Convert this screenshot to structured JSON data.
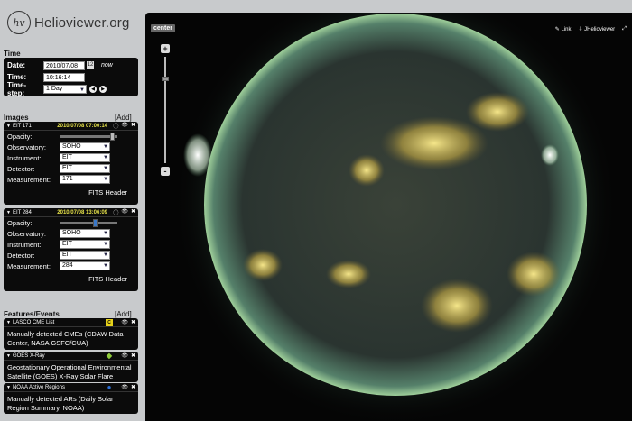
{
  "app": {
    "title": "Helioviewer.org",
    "logo_mark": "hv"
  },
  "time": {
    "section_title": "Time",
    "date_label": "Date:",
    "date_value": "2010/07/08",
    "now_label": "now",
    "time_label": "Time:",
    "time_value": "10:16:14",
    "step_label": "Time-step:",
    "step_value": "1 Day"
  },
  "images": {
    "section_title": "Images",
    "add_label": "[Add]",
    "layers": [
      {
        "name": "EIT 171",
        "timestamp": "2010/07/08 07:00:14",
        "opacity_label": "Opacity:",
        "opacity": 0.95,
        "observatory_label": "Observatory:",
        "observatory": "SOHO",
        "instrument_label": "Instrument:",
        "instrument": "EIT",
        "detector_label": "Detector:",
        "detector": "EIT",
        "measurement_label": "Measurement:",
        "measurement": "171",
        "fits_label": "FITS Header"
      },
      {
        "name": "EIT 284",
        "timestamp": "2010/07/08 13:06:09",
        "opacity_label": "Opacity:",
        "opacity": 0.62,
        "observatory_label": "Observatory:",
        "observatory": "SOHO",
        "instrument_label": "Instrument:",
        "instrument": "EIT",
        "detector_label": "Detector:",
        "detector": "EIT",
        "measurement_label": "Measurement:",
        "measurement": "284",
        "fits_label": "FITS Header"
      }
    ]
  },
  "features": {
    "section_title": "Features/Events",
    "add_label": "[Add]",
    "items": [
      {
        "name": "LASCO CME List",
        "badge": "C",
        "badge_color": "#e6d21a",
        "description": "Manually detected CMEs (CDAW Data Center, NASA GSFC/CUA)"
      },
      {
        "name": "GOES X-Ray",
        "badge": "◆",
        "badge_color": "#8ecb3a",
        "description": "Geostationary Operational Environmental Satellite (GOES) X-Ray Solar Flare Catalog"
      },
      {
        "name": "NOAA Active Regions",
        "badge": "●",
        "badge_color": "#2b6fd6",
        "description": "Manually detected ARs (Daily Solar Region Summary, NOAA)"
      }
    ]
  },
  "viewport": {
    "center_label": "center",
    "link_label": "Link",
    "jhelio_label": "JHelioviewer",
    "zoom_in": "+",
    "zoom_out": "-"
  },
  "colors": {
    "panel_bg": "#0b0b0b",
    "page_bg": "#c8cacc",
    "timestamp": "#e6e24a",
    "sun_corona": "#6fa07a",
    "sun_disk": "#2d3530"
  }
}
